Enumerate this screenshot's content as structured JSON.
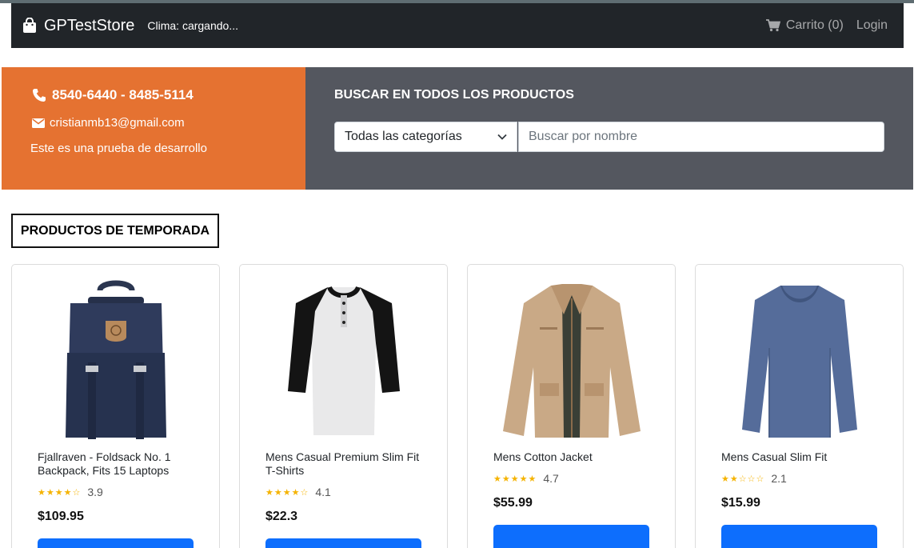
{
  "navbar": {
    "brand": "GPTestStore",
    "weather": "Clima: cargando...",
    "cart": "Carrito (0)",
    "login": "Login"
  },
  "contact": {
    "phone": "8540-6440 - 8485-5114",
    "email": "cristianmb13@gmail.com",
    "description": "Este es una prueba de desarrollo"
  },
  "search": {
    "title": "BUSCAR EN TODOS LOS PRODUCTOS",
    "category_selected": "Todas las categorías",
    "placeholder": "Buscar por nombre"
  },
  "section": {
    "title": "PRODUCTOS DE TEMPORADA"
  },
  "products": [
    {
      "name": "Fjallraven - Foldsack No. 1 Backpack, Fits 15 Laptops",
      "stars": "★★★★☆",
      "rating": "3.9",
      "price": "$109.95",
      "image": "backpack"
    },
    {
      "name": "Mens Casual Premium Slim Fit T-Shirts",
      "stars": "★★★★☆",
      "rating": "4.1",
      "price": "$22.3",
      "image": "raglan-shirt"
    },
    {
      "name": "Mens Cotton Jacket",
      "stars": "★★★★★",
      "rating": "4.7",
      "price": "$55.99",
      "image": "jacket"
    },
    {
      "name": "Mens Casual Slim Fit",
      "stars": "★★☆☆☆",
      "rating": "2.1",
      "price": "$15.99",
      "image": "long-sleeve-shirt"
    }
  ],
  "colors": {
    "navbar": "#212529",
    "contact_bg": "#e57231",
    "search_bg": "#54575f",
    "star": "#f5b301",
    "button": "#0d6efd"
  }
}
